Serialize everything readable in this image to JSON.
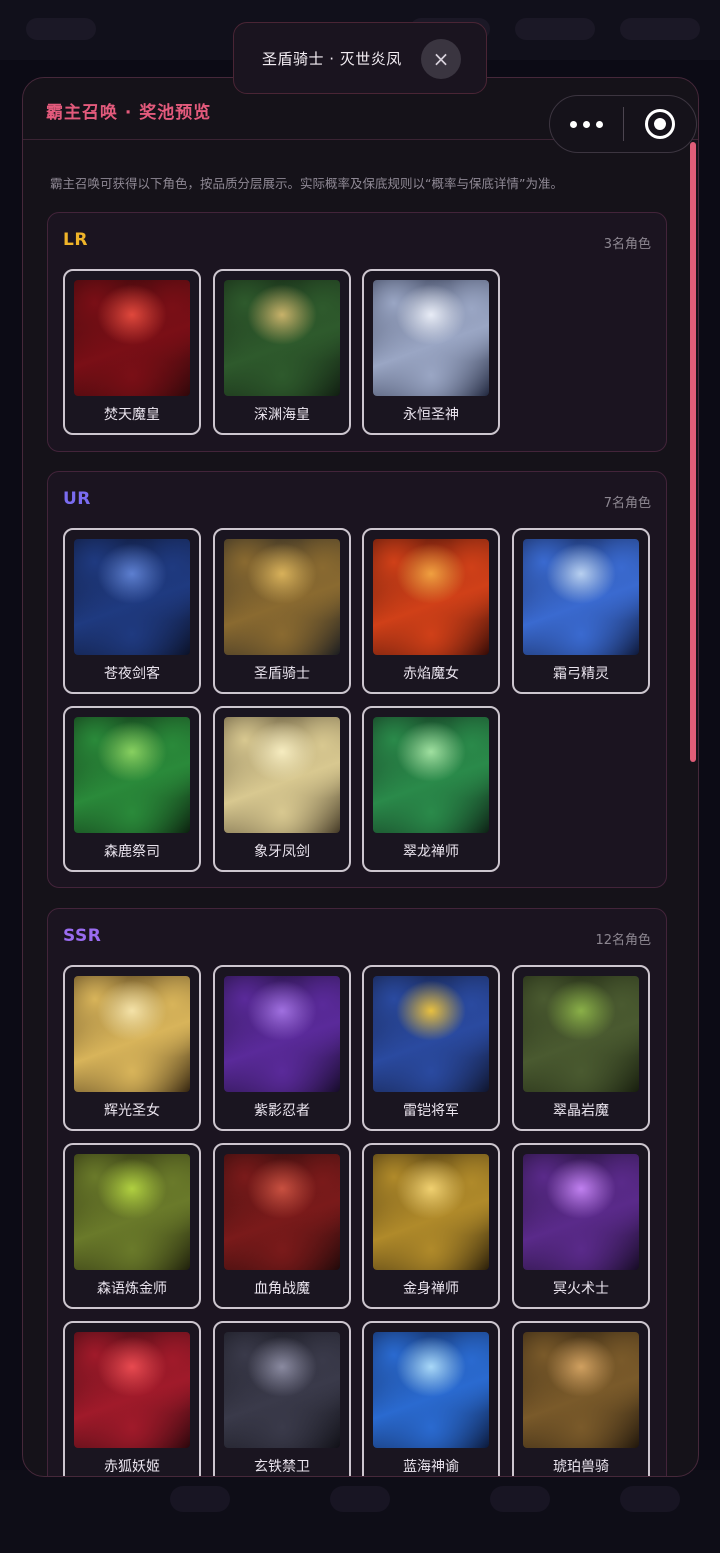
{
  "toast": {
    "text": "圣盾骑士 · 灭世炎凤",
    "close_icon": "×"
  },
  "panel": {
    "title": "霸主召唤 · 奖池预览",
    "intro": "霸主召唤可获得以下角色，按品质分层展示。实际概率及保底规则以“概率与保底详情”为准。"
  },
  "tiers": [
    {
      "label": "LR",
      "count": "3名角色",
      "color": "#f0b429",
      "characters": [
        {
          "name": "焚天魔皇",
          "palette": [
            "#7a0f16",
            "#2a0709",
            "#e0483c"
          ]
        },
        {
          "name": "深渊海皇",
          "palette": [
            "#2e5a2c",
            "#0f1a10",
            "#c8b26a"
          ]
        },
        {
          "name": "永恒圣神",
          "palette": [
            "#9aa6c4",
            "#1a2036",
            "#e8ecf6"
          ]
        }
      ]
    },
    {
      "label": "UR",
      "count": "7名角色",
      "color": "#7a6cf0",
      "characters": [
        {
          "name": "苍夜剑客",
          "palette": [
            "#1f3a80",
            "#0a0f22",
            "#5d7fd0"
          ]
        },
        {
          "name": "圣盾骑士",
          "palette": [
            "#8a6a30",
            "#141820",
            "#d8b15a"
          ]
        },
        {
          "name": "赤焰魔女",
          "palette": [
            "#d04018",
            "#2a0806",
            "#f0a040"
          ]
        },
        {
          "name": "霜弓精灵",
          "palette": [
            "#3a6ad0",
            "#0c1430",
            "#b8d0f0"
          ]
        },
        {
          "name": "森鹿祭司",
          "palette": [
            "#2a8a3a",
            "#0a1a0c",
            "#88d060"
          ]
        },
        {
          "name": "象牙凤剑",
          "palette": [
            "#d8c890",
            "#3a3020",
            "#f6ecc0"
          ]
        },
        {
          "name": "翠龙禅师",
          "palette": [
            "#2a8a4a",
            "#0c1a12",
            "#a0e0a0"
          ]
        }
      ]
    },
    {
      "label": "SSR",
      "count": "12名角色",
      "color": "#9a6cf0",
      "characters": [
        {
          "name": "辉光圣女",
          "palette": [
            "#d8b45a",
            "#2a1c0c",
            "#f4e2a8"
          ]
        },
        {
          "name": "紫影忍者",
          "palette": [
            "#5a2a9a",
            "#120a22",
            "#a070e0"
          ]
        },
        {
          "name": "雷铠将军",
          "palette": [
            "#2a4aa0",
            "#0e1226",
            "#e8c040"
          ]
        },
        {
          "name": "翠晶岩魔",
          "palette": [
            "#4a5a30",
            "#141a0c",
            "#8ab048"
          ]
        },
        {
          "name": "森语炼金师",
          "palette": [
            "#6a7a2a",
            "#1a1a0a",
            "#b0d040"
          ]
        },
        {
          "name": "血角战魔",
          "palette": [
            "#7a1a1a",
            "#1a0808",
            "#c85040"
          ]
        },
        {
          "name": "金身禅师",
          "palette": [
            "#b08a2a",
            "#221808",
            "#f0d070"
          ]
        },
        {
          "name": "冥火术士",
          "palette": [
            "#5a2a8a",
            "#120a1e",
            "#c080f0"
          ]
        },
        {
          "name": "赤狐妖姬",
          "palette": [
            "#a01a2a",
            "#22060a",
            "#e84a50"
          ]
        },
        {
          "name": "玄铁禁卫",
          "palette": [
            "#3a3a4a",
            "#0e0e14",
            "#8a8aa0"
          ]
        },
        {
          "name": "蓝海神谕",
          "palette": [
            "#2a6ad0",
            "#0a1430",
            "#a8d8f8"
          ]
        },
        {
          "name": "琥珀兽骑",
          "palette": [
            "#7a5a2a",
            "#1a120a",
            "#d0a060"
          ]
        }
      ]
    }
  ],
  "menu": {
    "more_icon": "more-dots",
    "close_icon": "target-circle"
  }
}
